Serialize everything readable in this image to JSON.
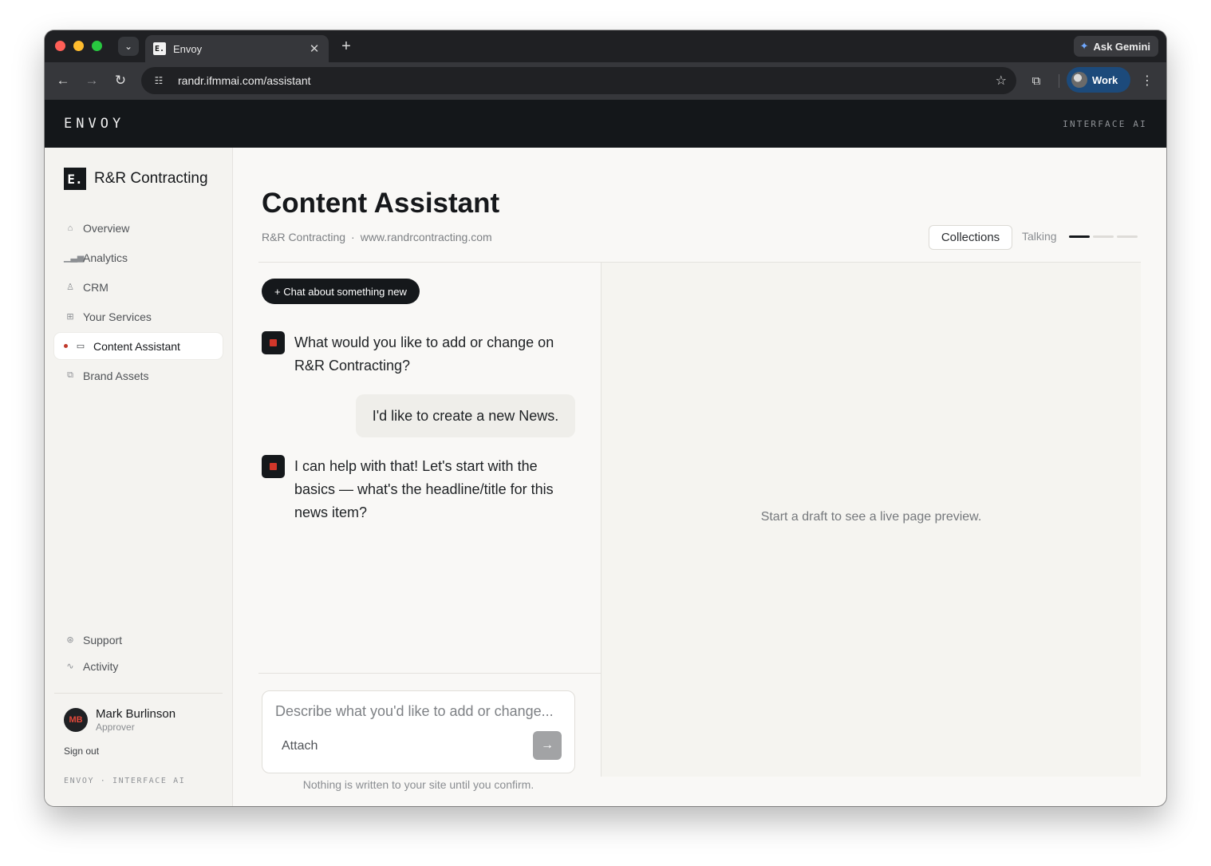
{
  "browser": {
    "tab_title": "Envoy",
    "tab_favicon": "E.",
    "new_tab_icon": "plus-icon",
    "ask_gemini_label": "Ask Gemini",
    "url": "randr.ifmmai.com/assistant",
    "profile_label": "Work"
  },
  "app_header": {
    "logo": "ENVOY",
    "tagline": "INTERFACE AI"
  },
  "sidebar": {
    "brand_mark": "E.",
    "brand_name": "R&R Contracting",
    "items": [
      {
        "label": "Overview",
        "icon": "home-icon"
      },
      {
        "label": "Analytics",
        "icon": "bar-chart-icon"
      },
      {
        "label": "CRM",
        "icon": "person-icon"
      },
      {
        "label": "Your Services",
        "icon": "grid-icon"
      },
      {
        "label": "Content Assistant",
        "icon": "chat-icon",
        "active": true
      },
      {
        "label": "Brand Assets",
        "icon": "images-icon"
      }
    ],
    "bottom_items": [
      {
        "label": "Support",
        "icon": "lifebuoy-icon"
      },
      {
        "label": "Activity",
        "icon": "pulse-icon"
      }
    ],
    "user": {
      "initials": "MB",
      "name": "Mark Burlinson",
      "role": "Approver"
    },
    "sign_out": "Sign out",
    "footer": "ENVOY · INTERFACE AI"
  },
  "main": {
    "title": "Content Assistant",
    "company": "R&R Contracting",
    "separator": "·",
    "website": "www.randrcontracting.com",
    "collections_label": "Collections",
    "status_label": "Talking",
    "status_step": 1,
    "status_steps": 3
  },
  "chat": {
    "new_chat_label": "+ Chat about something new",
    "messages": [
      {
        "role": "assistant",
        "text": "What would you like to add or change on R&R Contracting?"
      },
      {
        "role": "user",
        "text": "I'd like to create a new News."
      },
      {
        "role": "assistant",
        "text": "I can help with that! Let's start with the basics — what's the headline/title for this news item?"
      }
    ],
    "input_placeholder": "Describe what you'd like to add or change...",
    "attach_label": "Attach",
    "send_icon": "→",
    "disclaimer": "Nothing is written to your site until you confirm."
  },
  "preview": {
    "empty_text": "Start a draft to see a live page preview."
  },
  "colors": {
    "accent_dark": "#15181b",
    "accent_red": "#d2372a",
    "background": "#f9f8f6"
  }
}
